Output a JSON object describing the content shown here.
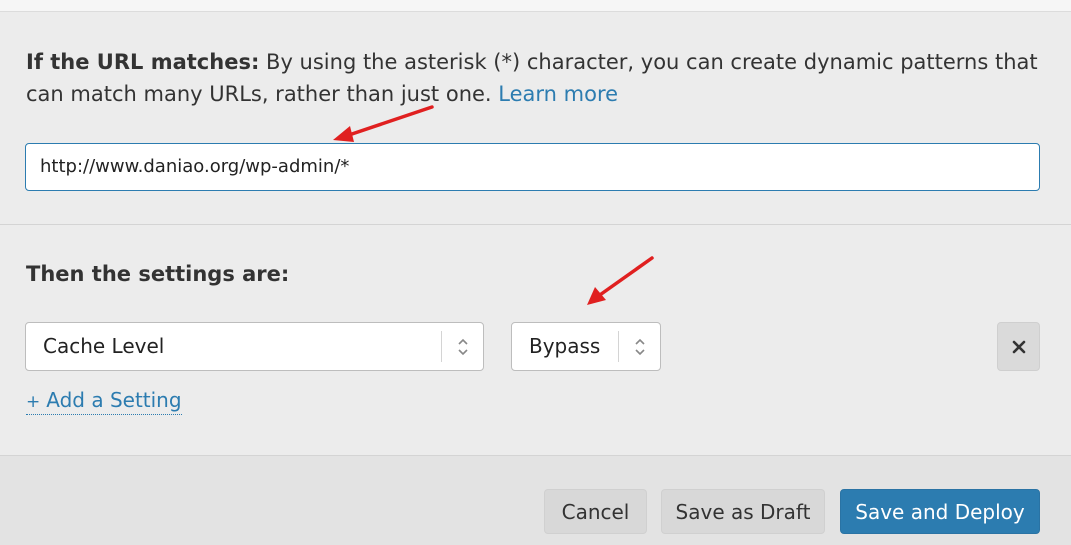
{
  "url_section": {
    "label_bold": "If the URL matches:",
    "description": " By using the asterisk (*) character, you can create dynamic patterns that can match many URLs, rather than just one. ",
    "learn_more": "Learn more",
    "url_value": "http://www.daniao.org/wp-admin/*"
  },
  "settings_section": {
    "heading": "Then the settings are:",
    "setting_select": "Cache Level",
    "value_select": "Bypass",
    "add_setting": "Add a Setting",
    "add_plus": "+"
  },
  "footer": {
    "cancel": "Cancel",
    "save_draft": "Save as Draft",
    "save_deploy": "Save and Deploy"
  },
  "colors": {
    "accent": "#2c7cb0",
    "annotation_arrow": "#e02020"
  }
}
